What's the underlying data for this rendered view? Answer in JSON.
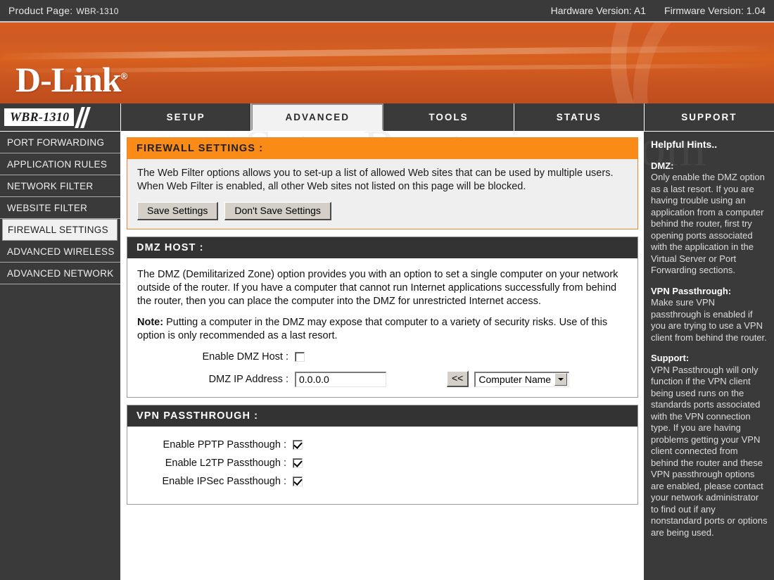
{
  "topbar": {
    "product_label": "Product Page:",
    "product_model": "WBR-1310",
    "hardware_version": "Hardware Version: A1",
    "firmware_version": "Firmware Version: 1.04"
  },
  "banner": {
    "brand": "D-Link",
    "trademark": "®"
  },
  "nav": {
    "model_chip": "WBR-1310",
    "tabs": [
      {
        "label": "SETUP",
        "active": false
      },
      {
        "label": "ADVANCED",
        "active": true
      },
      {
        "label": "TOOLS",
        "active": false
      },
      {
        "label": "STATUS",
        "active": false
      },
      {
        "label": "SUPPORT",
        "active": false
      }
    ]
  },
  "sidebar": {
    "items": [
      {
        "label": "PORT FORWARDING",
        "active": false
      },
      {
        "label": "APPLICATION RULES",
        "active": false
      },
      {
        "label": "NETWORK FILTER",
        "active": false
      },
      {
        "label": "WEBSITE FILTER",
        "active": false
      },
      {
        "label": "FIREWALL SETTINGS",
        "active": true
      },
      {
        "label": "ADVANCED WIRELESS",
        "active": false
      },
      {
        "label": "ADVANCED NETWORK",
        "active": false
      }
    ]
  },
  "watermark": "SetupRouter.com",
  "firewall_panel": {
    "title": "FIREWALL SETTINGS :",
    "description": "The Web Filter options allows you to set-up a list of allowed Web sites that can be used by multiple users. When Web Filter is enabled, all other Web sites not listed on this page will be blocked.",
    "save_button": "Save Settings",
    "dont_save_button": "Don't Save Settings"
  },
  "dmz_panel": {
    "title": "DMZ HOST :",
    "description": "The DMZ (Demilitarized Zone) option provides you with an option to set a single computer on your network outside of the router. If you have a computer that cannot run Internet applications successfully from behind the router, then you can place the computer into the DMZ for unrestricted Internet access.",
    "note_label": "Note:",
    "note_text": " Putting a computer in the DMZ may expose that computer to a variety of security risks. Use of this option is only recommended as a last resort.",
    "enable_label": "Enable DMZ Host :",
    "enable_checked": false,
    "ip_label": "DMZ IP Address :",
    "ip_value": "0.0.0.0",
    "copy_button": "<<",
    "computer_select": "Computer Name"
  },
  "vpn_panel": {
    "title": "VPN PASSTHROUGH :",
    "rows": [
      {
        "label": "Enable PPTP Passthough :",
        "checked": true
      },
      {
        "label": "Enable L2TP Passthough :",
        "checked": true
      },
      {
        "label": "Enable IPSec Passthough :",
        "checked": true
      }
    ]
  },
  "hints": {
    "title": "Helpful Hints..",
    "blocks": [
      {
        "head": "DMZ:",
        "text": "Only enable the DMZ option as a last resort. If you are having trouble using an application from a computer behind the router, first try opening ports associated with the application in the Virtual Server or Port Forwarding sections."
      },
      {
        "head": "VPN Passthrough:",
        "text": "Make sure VPN passthrough is enabled if you are trying to use a VPN client from behind the router."
      },
      {
        "head": "Support:",
        "text": "VPN Passthrough will only function if the VPN client being used runs on the standards ports associated with the VPN connection type. If you are having problems getting your VPN client connected from behind the router and these VPN passthrough options are enabled, please contact your network administrator to find out if any nonstandard ports or options are being used."
      }
    ]
  },
  "colors": {
    "accent_orange": "#fb8b17",
    "banner_orange": "#d8611f",
    "dark_panel": "#333333",
    "chrome_dark": "#3a3a3a"
  }
}
